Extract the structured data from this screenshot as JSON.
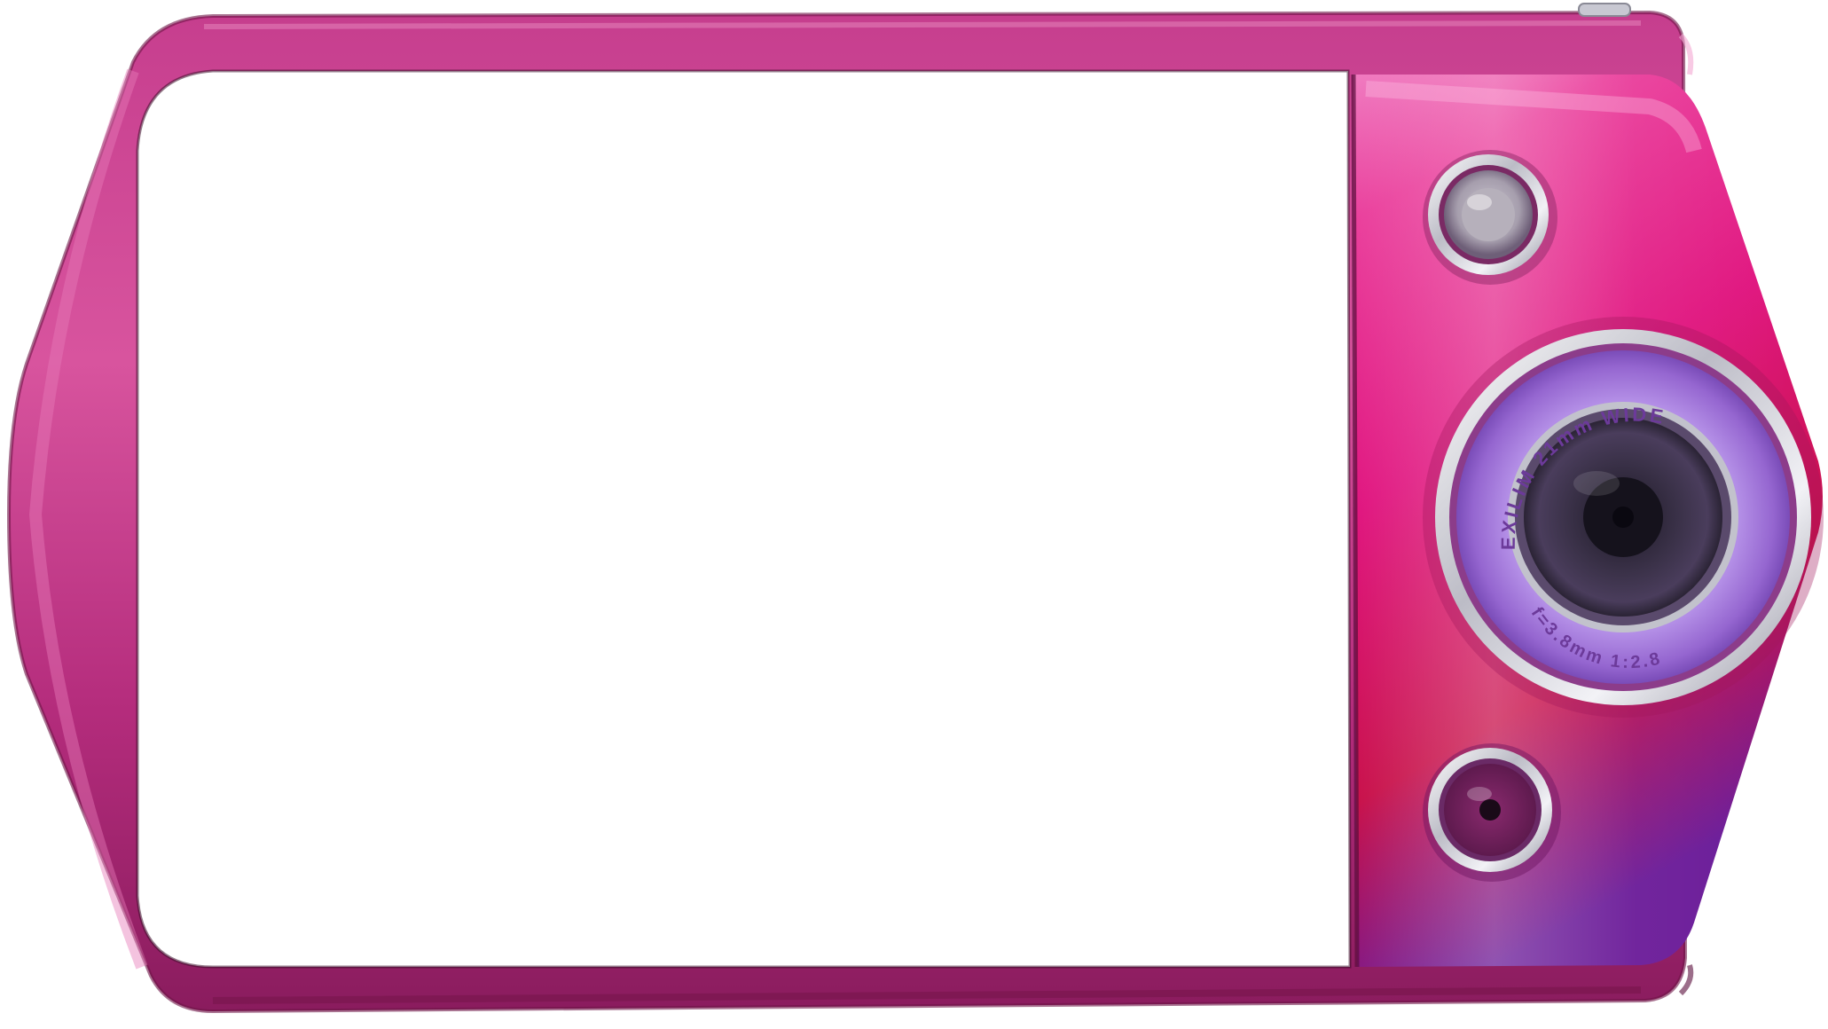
{
  "image": {
    "subject": "camera-frame-overlay",
    "colors": {
      "frame_light": "#d8549e",
      "frame_mid": "#b42c7c",
      "frame_dark": "#7a1750",
      "module_light": "#f07ac0",
      "module_mid": "#e0157f",
      "module_deep": "#c8104a",
      "module_purple": "#6a1a98",
      "ring_silver": "#e3e3ea",
      "lens_violet": "#a47fd8",
      "lens_dark": "#2d2838",
      "screen": "#ffffff"
    }
  },
  "lens": {
    "ring_text_top": "EXILIM 21mm WIDE",
    "ring_text_bottom": "f=3.8mm 1:2.8"
  }
}
